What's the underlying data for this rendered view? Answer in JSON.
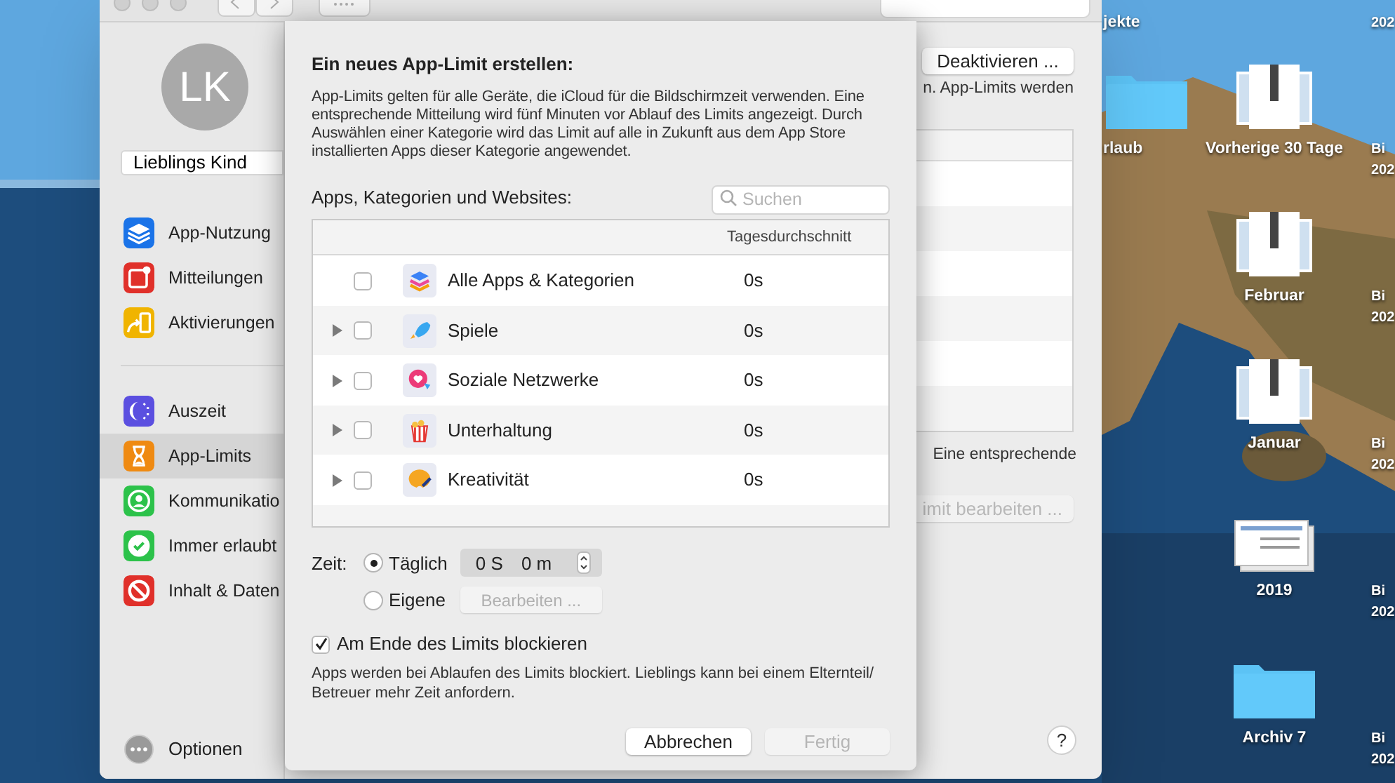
{
  "desktop": {
    "columns": [
      [
        {
          "label": [
            "jekte"
          ]
        },
        {
          "kind": "folder",
          "label": [
            "rlaub"
          ]
        }
      ],
      [
        {
          "kind": "zip",
          "label": [
            "Vorherige 30 Tage"
          ]
        },
        {
          "kind": "zip",
          "label": [
            "Februar"
          ]
        },
        {
          "kind": "zip",
          "label": [
            "Januar"
          ]
        },
        {
          "kind": "document",
          "label": [
            "2019"
          ]
        },
        {
          "kind": "folder",
          "label": [
            "Archiv 7"
          ]
        }
      ],
      [
        {
          "label": [
            "202"
          ]
        },
        {
          "label": [
            "Bi",
            "202"
          ]
        },
        {
          "label": [
            "Bi",
            "202"
          ]
        },
        {
          "label": [
            "Bi",
            "202"
          ]
        },
        {
          "label": [
            "Bi",
            "202"
          ]
        },
        {
          "label": [
            "Bi",
            "202"
          ]
        }
      ]
    ]
  },
  "window": {
    "sidebar": {
      "avatar": "LK",
      "user": "Lieblings Kind",
      "groups": [
        [
          {
            "label": "App-Nutzung",
            "color": "#1a73e8",
            "selected": false
          },
          {
            "label": "Mitteilungen",
            "color": "#e0302a",
            "selected": false
          },
          {
            "label": "Aktivierungen",
            "color": "#f0b400",
            "selected": false
          }
        ],
        [
          {
            "label": "Auszeit",
            "color": "#5b4fe0",
            "selected": false
          },
          {
            "label": "App-Limits",
            "color": "#ef8a12",
            "selected": true
          },
          {
            "label": "Kommunikatio",
            "color": "#2cc24a",
            "selected": false
          },
          {
            "label": "Immer erlaubt",
            "color": "#2cc24a",
            "selected": false
          },
          {
            "label": "Inhalt & Daten",
            "color": "#e0302a",
            "selected": false
          }
        ]
      ],
      "options": "Optionen"
    },
    "content": {
      "deactivate_button": "Deaktivieren ...",
      "text_1": "n. App-Limits werden",
      "text_2": "Eine entsprechende",
      "edit_button": {
        "label": "imit bearbeiten ...",
        "disabled": true
      },
      "help": "?"
    }
  },
  "sheet": {
    "title": "Ein neues App-Limit erstellen:",
    "description": "App-Limits gelten für alle Geräte, die iCloud für die Bildschirmzeit verwenden. Eine entsprechende Mitteilung wird fünf Minuten vor Ablauf des Limits angezeigt. Durch Auswählen einer Kategorie wird das Limit auf alle in Zukunft aus dem App Store installierten Apps dieser Kategorie angewendet.",
    "list_label": "Apps, Kategorien und Websites:",
    "search_placeholder": "Suchen",
    "table": {
      "column": "Tagesdurchschnitt",
      "rows": [
        {
          "name": "Alle Apps & Kategorien",
          "value": "0s",
          "expandable": false,
          "checked": false
        },
        {
          "name": "Spiele",
          "value": "0s",
          "expandable": true,
          "checked": false
        },
        {
          "name": "Soziale Netzwerke",
          "value": "0s",
          "expandable": true,
          "checked": false
        },
        {
          "name": "Unterhaltung",
          "value": "0s",
          "expandable": true,
          "checked": false
        },
        {
          "name": "Kreativität",
          "value": "0s",
          "expandable": true,
          "checked": false
        }
      ]
    },
    "time": {
      "label": "Zeit:",
      "options": [
        {
          "label": "Täglich",
          "selected": true
        },
        {
          "label": "Eigene",
          "selected": false
        }
      ],
      "hours": "0 S",
      "minutes": "0 m",
      "edit_button": {
        "label": "Bearbeiten ...",
        "disabled": true
      }
    },
    "block": {
      "label": "Am Ende des Limits blockieren",
      "checked": true
    },
    "note": "Apps werden bei Ablaufen des Limits blockiert. Lieblings kann bei einem Elternteil/ Betreuer mehr Zeit anfordern.",
    "buttons": [
      {
        "label": "Abbrechen",
        "disabled": false
      },
      {
        "label": "Fertig",
        "disabled": true
      }
    ]
  }
}
